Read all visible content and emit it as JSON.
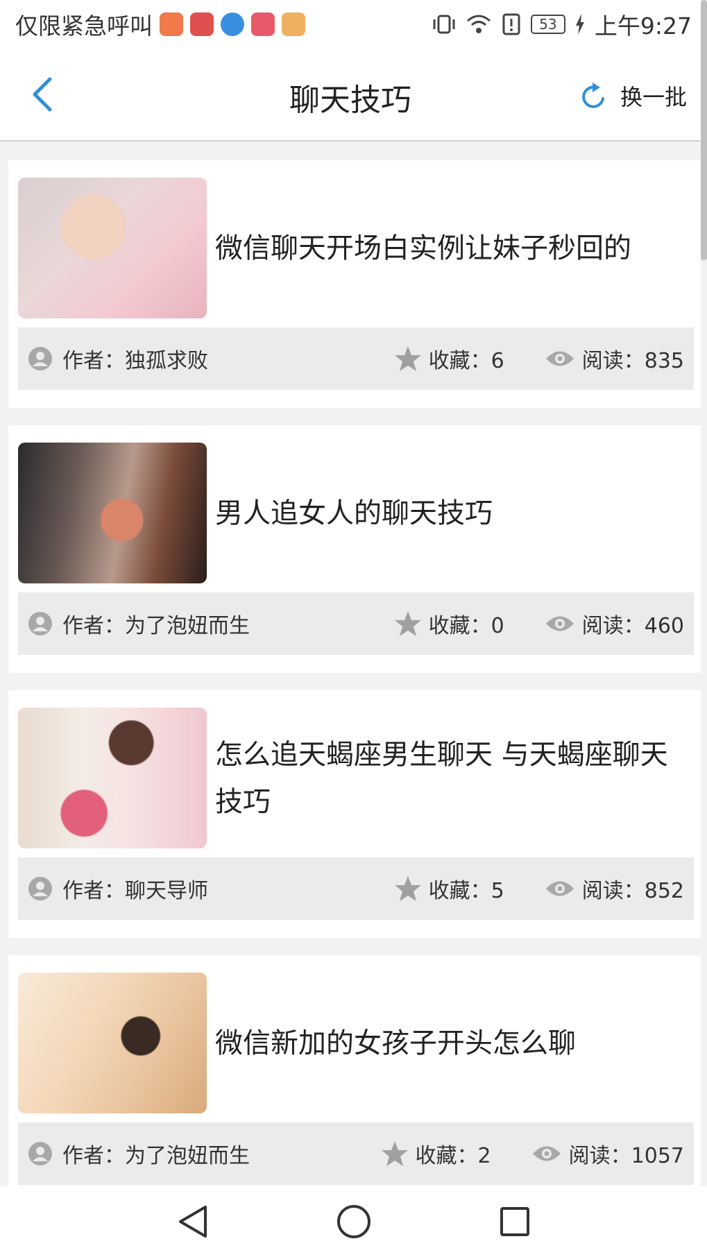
{
  "status_bar": {
    "carrier_text": "仅限紧急呼叫",
    "battery": "53",
    "time": "上午9:27",
    "app_icon_colors": [
      "#f07a4a",
      "#e0504e",
      "#3b8fe0",
      "#e85a6b",
      "#f0b060"
    ]
  },
  "nav": {
    "title": "聊天技巧",
    "refresh_label": "换一批",
    "accent_color": "#2f8fd8"
  },
  "articles": [
    {
      "title": "微信聊天开场白实例让妹子秒回的",
      "author_label": "作者：独孤求败",
      "favorites_label": "收藏：6",
      "reads_label": "阅读：835"
    },
    {
      "title": "男人追女人的聊天技巧",
      "author_label": "作者：为了泡妞而生",
      "favorites_label": "收藏：0",
      "reads_label": "阅读：460"
    },
    {
      "title": "怎么追天蝎座男生聊天 与天蝎座聊天技巧",
      "author_label": "作者：聊天导师",
      "favorites_label": "收藏：5",
      "reads_label": "阅读：852"
    },
    {
      "title": "微信新加的女孩子开头怎么聊",
      "author_label": "作者：为了泡妞而生",
      "favorites_label": "收藏：2",
      "reads_label": "阅读：1057"
    }
  ]
}
